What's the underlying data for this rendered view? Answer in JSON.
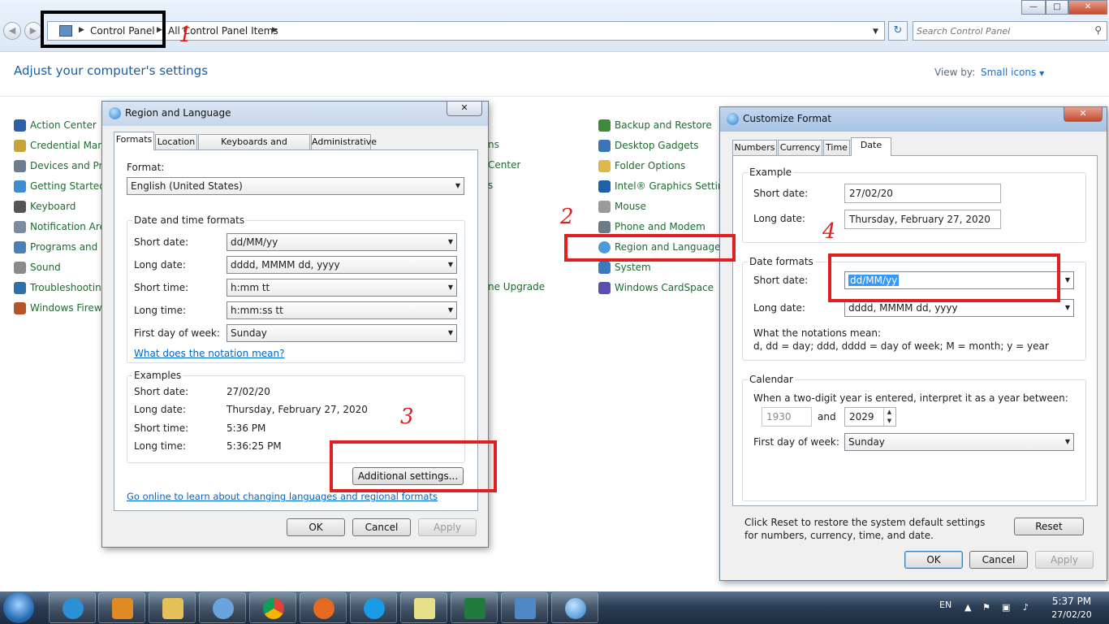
{
  "address_bar": {
    "crumbs": [
      "Control Panel",
      "All Control Panel Items"
    ],
    "search_placeholder": "Search Control Panel"
  },
  "control_panel": {
    "title": "Adjust your computer's settings",
    "view_by_label": "View by:",
    "view_by_value": "Small icons",
    "col1": [
      "Action Center",
      "Credential Mana",
      "Devices and Prin",
      "Getting Started",
      "Keyboard",
      "Notification Area",
      "Programs and Fe",
      "Sound",
      "Troubleshooting",
      "Windows Firewal"
    ],
    "col2_fragments": [
      "ns",
      "Center",
      "s",
      "ne Upgrade"
    ],
    "col3": [
      "Backup and Restore",
      "Desktop Gadgets",
      "Folder Options",
      "Intel® Graphics Settings",
      "Mouse",
      "Phone and Modem",
      "Region and Language",
      "System",
      "Windows CardSpace"
    ]
  },
  "region_dialog": {
    "title": "Region and Language",
    "tabs": [
      "Formats",
      "Location",
      "Keyboards and Languages",
      "Administrative"
    ],
    "format_label": "Format:",
    "format_value": "English (United States)",
    "dt_group": "Date and time formats",
    "dt_rows": [
      {
        "label": "Short date:",
        "value": "dd/MM/yy"
      },
      {
        "label": "Long date:",
        "value": "dddd, MMMM dd, yyyy"
      },
      {
        "label": "Short time:",
        "value": "h:mm tt"
      },
      {
        "label": "Long time:",
        "value": "h:mm:ss tt"
      },
      {
        "label": "First day of week:",
        "value": "Sunday"
      }
    ],
    "notation_link": "What does the notation mean?",
    "examples_group": "Examples",
    "examples": [
      {
        "label": "Short date:",
        "value": "27/02/20"
      },
      {
        "label": "Long date:",
        "value": "Thursday, February 27, 2020"
      },
      {
        "label": "Short time:",
        "value": "5:36 PM"
      },
      {
        "label": "Long time:",
        "value": "5:36:25 PM"
      }
    ],
    "additional_btn": "Additional settings...",
    "online_link": "Go online to learn about changing languages and regional formats",
    "ok": "OK",
    "cancel": "Cancel",
    "apply": "Apply"
  },
  "customize_dialog": {
    "title": "Customize Format",
    "tabs": [
      "Numbers",
      "Currency",
      "Time",
      "Date"
    ],
    "example_group": "Example",
    "example_short_label": "Short date:",
    "example_short_value": "27/02/20",
    "example_long_label": "Long date:",
    "example_long_value": "Thursday, February 27, 2020",
    "formats_group": "Date formats",
    "short_label": "Short date:",
    "short_value": "dd/MM/yy",
    "long_label": "Long date:",
    "long_value": "dddd, MMMM dd, yyyy",
    "notations_title": "What the notations mean:",
    "notations_text": "d, dd = day;  ddd, dddd = day of week;  M = month;  y = year",
    "calendar_group": "Calendar",
    "calendar_text": "When a two-digit year is entered, interpret it as a year between:",
    "year_from": "1930",
    "and_label": "and",
    "year_to": "2029",
    "first_day_label": "First day of week:",
    "first_day_value": "Sunday",
    "reset_text": "Click Reset to restore the system default settings for numbers, currency, time, and date.",
    "reset": "Reset",
    "ok": "OK",
    "cancel": "Cancel",
    "apply": "Apply"
  },
  "annotations": [
    "1",
    "2",
    "3",
    "4"
  ],
  "taskbar": {
    "lang": "EN",
    "time": "5:37 PM",
    "date": "27/02/20"
  }
}
